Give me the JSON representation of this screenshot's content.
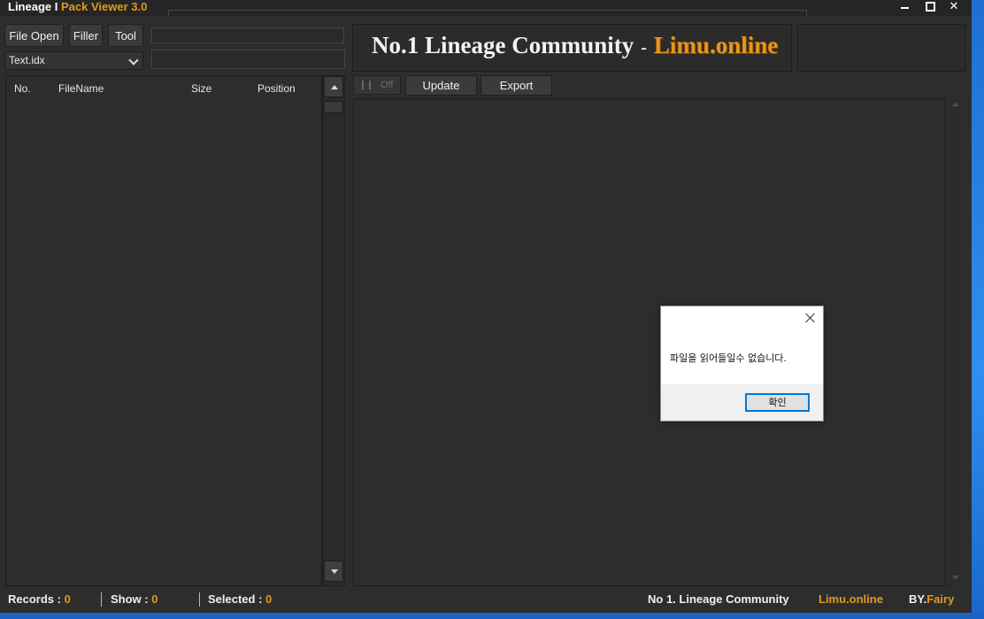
{
  "window": {
    "title_part1": "Lineage I",
    "title_part2": "Pack Viewer 3.0"
  },
  "toolbar": {
    "file_open": "File Open",
    "filler": "Filler",
    "tool": "Tool"
  },
  "combo": {
    "selected": "Text.idx"
  },
  "list": {
    "columns": [
      "No.",
      "FileName",
      "Size",
      "Position"
    ]
  },
  "banner": {
    "text": "No.1 Lineage Community",
    "separator": "-",
    "site": "Limu.online"
  },
  "viewer_toolbar": {
    "toggle_label": "Off",
    "update": "Update",
    "export": "Export"
  },
  "status": {
    "records_label": "Records :",
    "records_value": "0",
    "show_label": "Show :",
    "show_value": "0",
    "selected_label": "Selected :",
    "selected_value": "0",
    "community": "No 1. Lineage Community",
    "site": "Limu.online",
    "by_label": "BY.",
    "by_value": "Fairy"
  },
  "dialog": {
    "message": "파일을 읽어들일수 없습니다.",
    "ok": "확인"
  },
  "colors": {
    "accent": "#e19a1c",
    "background": "#2d2d2d"
  }
}
